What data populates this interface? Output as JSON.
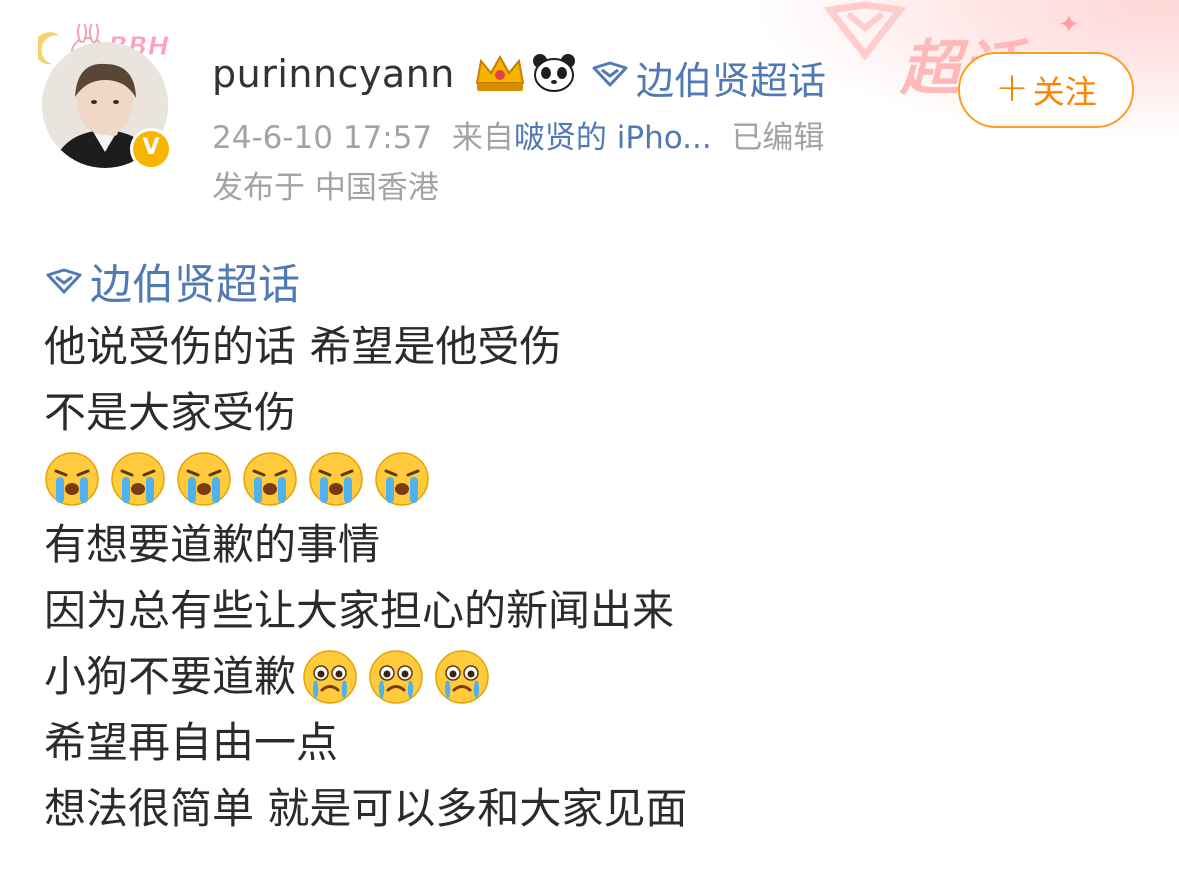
{
  "header": {
    "avatar_frame_text": "BBH",
    "username": "purinncyann",
    "badge_icons": [
      "crown-icon",
      "panda-icon"
    ],
    "topic_link": "边伯贤超话",
    "timestamp": "24-6-10 17:57",
    "source_prefix": "来自",
    "source_device": "啵贤的 iPho...",
    "edited_label": "已编辑",
    "location": "发布于 中国香港",
    "follow_button": "关注",
    "deco_text": "超话",
    "colors": {
      "link": "#4f7ab3",
      "meta": "#a3a3a3",
      "follow": "#ff8200"
    }
  },
  "post": {
    "topic_tag": "边伯贤超话",
    "lines": [
      "他说受伤的话 希望是他受伤",
      "不是大家受伤"
    ],
    "emoji_row_1": [
      "crying-emoji",
      "crying-emoji",
      "crying-emoji",
      "crying-emoji",
      "crying-emoji",
      "crying-emoji"
    ],
    "lines2": [
      "有想要道歉的事情",
      "因为总有些让大家担心的新闻出来"
    ],
    "sorry_line": "小狗不要道歉",
    "emoji_row_2": [
      "teary-emoji",
      "teary-emoji",
      "teary-emoji"
    ],
    "lines3": [
      "希望再自由一点",
      "想法很简单 就是可以多和大家见面"
    ]
  }
}
